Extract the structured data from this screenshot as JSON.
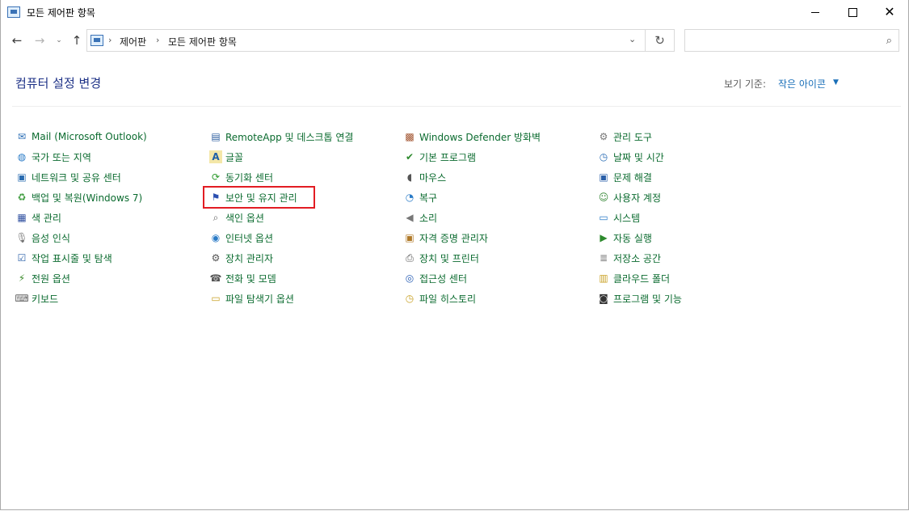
{
  "window": {
    "title": "모든 제어판 항목",
    "min_glyph": "",
    "close_glyph": "✕"
  },
  "nav": {
    "back_glyph": "←",
    "forward_glyph": "→",
    "recent_glyph": "⌄",
    "up_glyph": "↑",
    "breadcrumbs": [
      "제어판",
      "모든 제어판 항목"
    ],
    "sep_glyph": "›",
    "dropdown_glyph": "⌄",
    "refresh_glyph": "↻",
    "search_placeholder": "",
    "search_glyph": "⌕"
  },
  "heading": {
    "title": "컴퓨터 설정 변경",
    "view_by_label": "보기 기준:",
    "view_by_value": "작은 아이콘",
    "caret": "▼"
  },
  "columns": [
    [
      {
        "label": "Mail (Microsoft Outlook)",
        "icon": "mail-icon",
        "glyph": "✉",
        "color": "#2a6db5"
      },
      {
        "label": "국가 또는 지역",
        "icon": "globe-clock-icon",
        "glyph": "◍",
        "color": "#2a7bc7"
      },
      {
        "label": "네트워크 및 공유 센터",
        "icon": "network-icon",
        "glyph": "▣",
        "color": "#2b6cb0"
      },
      {
        "label": "백업 및 복원(Windows 7)",
        "icon": "backup-icon",
        "glyph": "♻",
        "color": "#3a9a3a"
      },
      {
        "label": "색 관리",
        "icon": "color-management-icon",
        "glyph": "▦",
        "color": "#3050a0"
      },
      {
        "label": "음성 인식",
        "icon": "microphone-icon",
        "glyph": "🎙",
        "color": "#777777"
      },
      {
        "label": "작업 표시줄 및 탐색",
        "icon": "taskbar-icon",
        "glyph": "☑",
        "color": "#2a5fa8"
      },
      {
        "label": "전원 옵션",
        "icon": "power-icon",
        "glyph": "⚡",
        "color": "#3a8a2a"
      },
      {
        "label": "키보드",
        "icon": "keyboard-icon",
        "glyph": "⌨",
        "color": "#666666"
      }
    ],
    [
      {
        "label": "RemoteApp 및 데스크톱 연결",
        "icon": "remoteapp-icon",
        "glyph": "▤",
        "color": "#2d5fa0"
      },
      {
        "label": "글꼴",
        "icon": "fonts-icon",
        "glyph": "A",
        "color": "#1f5fa8"
      },
      {
        "label": "동기화 센터",
        "icon": "sync-icon",
        "glyph": "⟳",
        "color": "#2d9a2d"
      },
      {
        "label": "보안 및 유지 관리",
        "icon": "flag-icon",
        "glyph": "⚑",
        "color": "#2a4fb0"
      },
      {
        "label": "색인 옵션",
        "icon": "indexing-icon",
        "glyph": "⌕",
        "color": "#666666"
      },
      {
        "label": "인터넷 옵션",
        "icon": "internet-options-icon",
        "glyph": "◉",
        "color": "#2a7bc7"
      },
      {
        "label": "장치 관리자",
        "icon": "device-manager-icon",
        "glyph": "⚙",
        "color": "#555555"
      },
      {
        "label": "전화 및 모뎀",
        "icon": "phone-modem-icon",
        "glyph": "☎",
        "color": "#555555"
      },
      {
        "label": "파일 탐색기 옵션",
        "icon": "folder-options-icon",
        "glyph": "▭",
        "color": "#c9a227"
      }
    ],
    [
      {
        "label": "Windows Defender 방화벽",
        "icon": "firewall-icon",
        "glyph": "▩",
        "color": "#a0522d"
      },
      {
        "label": "기본 프로그램",
        "icon": "default-programs-icon",
        "glyph": "✔",
        "color": "#2d8a2d"
      },
      {
        "label": "마우스",
        "icon": "mouse-icon",
        "glyph": "◖",
        "color": "#555555"
      },
      {
        "label": "복구",
        "icon": "recovery-icon",
        "glyph": "◔",
        "color": "#2a7bc7"
      },
      {
        "label": "소리",
        "icon": "speaker-icon",
        "glyph": "◀",
        "color": "#777777"
      },
      {
        "label": "자격 증명 관리자",
        "icon": "credential-icon",
        "glyph": "▣",
        "color": "#b07a2a"
      },
      {
        "label": "장치 및 프린터",
        "icon": "printer-icon",
        "glyph": "⎙",
        "color": "#555555"
      },
      {
        "label": "접근성 센터",
        "icon": "ease-of-access-icon",
        "glyph": "◎",
        "color": "#2a5fb5"
      },
      {
        "label": "파일 히스토리",
        "icon": "file-history-icon",
        "glyph": "◷",
        "color": "#c9a227"
      }
    ],
    [
      {
        "label": "관리 도구",
        "icon": "admin-tools-icon",
        "glyph": "⚙",
        "color": "#777777"
      },
      {
        "label": "날짜 및 시간",
        "icon": "calendar-clock-icon",
        "glyph": "◷",
        "color": "#2a6db5"
      },
      {
        "label": "문제 해결",
        "icon": "troubleshoot-icon",
        "glyph": "▣",
        "color": "#2a5fa8"
      },
      {
        "label": "사용자 계정",
        "icon": "user-accounts-icon",
        "glyph": "☺",
        "color": "#3a8a3a"
      },
      {
        "label": "시스템",
        "icon": "system-icon",
        "glyph": "▭",
        "color": "#2a7bc7"
      },
      {
        "label": "자동 실행",
        "icon": "autoplay-icon",
        "glyph": "▶",
        "color": "#2d8a2d"
      },
      {
        "label": "저장소 공간",
        "icon": "storage-icon",
        "glyph": "≣",
        "color": "#777777"
      },
      {
        "label": "클라우드 폴더",
        "icon": "cloud-folder-icon",
        "glyph": "▥",
        "color": "#c9a227"
      },
      {
        "label": "프로그램 및 기능",
        "icon": "programs-features-icon",
        "glyph": "◙",
        "color": "#333333"
      }
    ]
  ]
}
